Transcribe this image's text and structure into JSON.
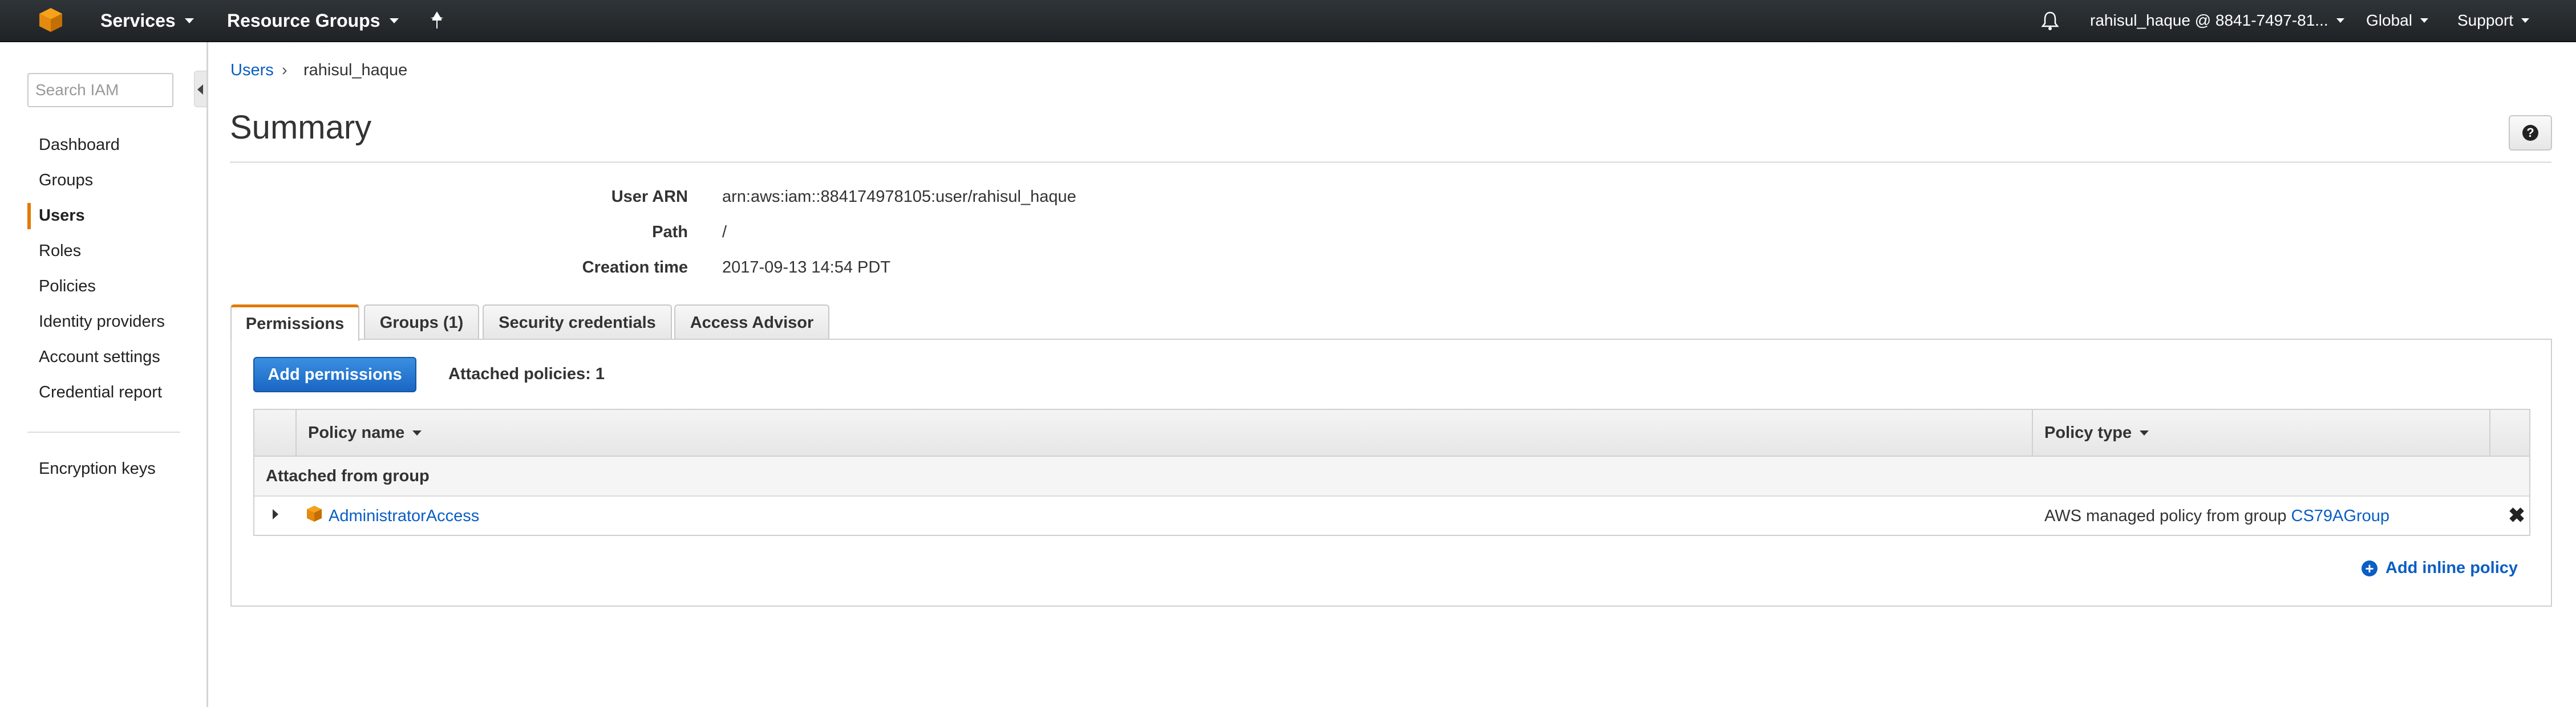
{
  "topbar": {
    "services": "Services",
    "resource_groups": "Resource Groups",
    "account": "rahisul_haque @ 8841-7497-81...",
    "region": "Global",
    "support": "Support"
  },
  "sidebar": {
    "search_placeholder": "Search IAM",
    "items": [
      {
        "label": "Dashboard"
      },
      {
        "label": "Groups"
      },
      {
        "label": "Users"
      },
      {
        "label": "Roles"
      },
      {
        "label": "Policies"
      },
      {
        "label": "Identity providers"
      },
      {
        "label": "Account settings"
      },
      {
        "label": "Credential report"
      }
    ],
    "active_item": "Users",
    "extra": {
      "label": "Encryption keys"
    }
  },
  "breadcrumb": {
    "parent": "Users",
    "current": "rahisul_haque"
  },
  "page_title": "Summary",
  "summary": [
    {
      "label": "User ARN",
      "value": "arn:aws:iam::884174978105:user/rahisul_haque"
    },
    {
      "label": "Path",
      "value": "/"
    },
    {
      "label": "Creation time",
      "value": "2017-09-13 14:54 PDT"
    }
  ],
  "tabs": [
    {
      "label": "Permissions",
      "active": true
    },
    {
      "label": "Groups (1)",
      "active": false
    },
    {
      "label": "Security credentials",
      "active": false
    },
    {
      "label": "Access Advisor",
      "active": false
    }
  ],
  "permissions": {
    "add_button": "Add permissions",
    "attached_count": "Attached policies: 1",
    "columns": {
      "name": "Policy name",
      "type": "Policy type"
    },
    "group_header": "Attached from group",
    "rows": [
      {
        "name": "AdministratorAccess",
        "type_prefix": "AWS managed policy from group",
        "group_link": "CS79AGroup"
      }
    ],
    "add_inline": "Add inline policy"
  },
  "colors": {
    "accent": "#e07b00",
    "link": "#0a5ec4",
    "primary_button": "#1a66c4",
    "topbar": "#232f3e"
  }
}
